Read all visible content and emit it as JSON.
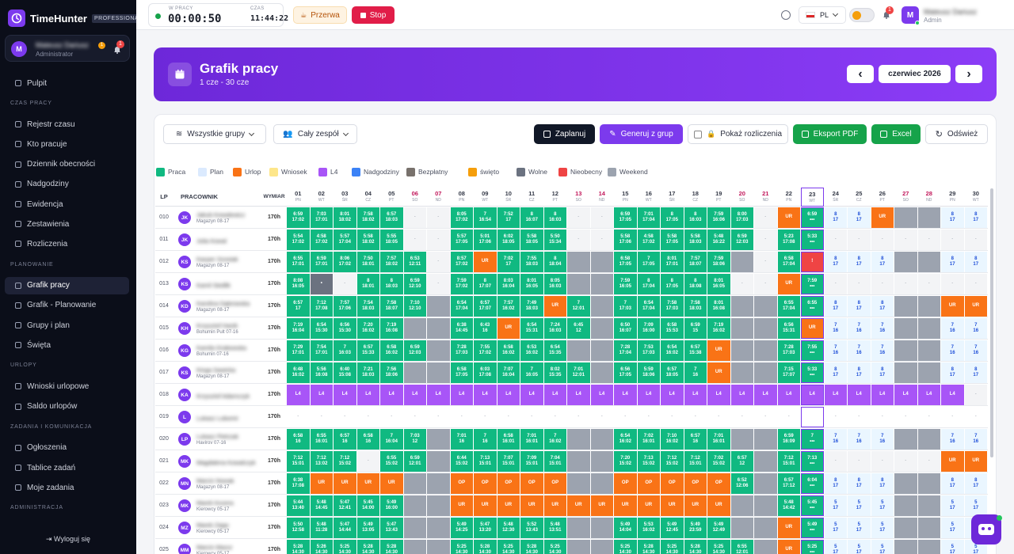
{
  "brand": {
    "name": "TimeHunter",
    "badge": "PROFESSIONAL"
  },
  "user": {
    "initial": "M",
    "name": "Mateusz Dariusz",
    "role": "Administrator",
    "badge_count": "1",
    "notif_count": "1"
  },
  "nav": [
    {
      "type": "item",
      "label": "Pulpit",
      "active": false
    },
    {
      "type": "section",
      "label": "CZAS PRACY"
    },
    {
      "type": "item",
      "label": "Rejestr czasu",
      "active": false
    },
    {
      "type": "item",
      "label": "Kto pracuje",
      "active": false
    },
    {
      "type": "item",
      "label": "Dziennik obecności",
      "active": false
    },
    {
      "type": "item",
      "label": "Nadgodziny",
      "active": false
    },
    {
      "type": "item",
      "label": "Ewidencja",
      "active": false
    },
    {
      "type": "item",
      "label": "Zestawienia",
      "active": false
    },
    {
      "type": "item",
      "label": "Rozliczenia",
      "active": false
    },
    {
      "type": "section",
      "label": "PLANOWANIE"
    },
    {
      "type": "item",
      "label": "Grafik pracy",
      "active": true
    },
    {
      "type": "item",
      "label": "Grafik - Planowanie",
      "active": false
    },
    {
      "type": "item",
      "label": "Grupy i plan",
      "active": false
    },
    {
      "type": "item",
      "label": "Święta",
      "active": false
    },
    {
      "type": "section",
      "label": "URLOPY"
    },
    {
      "type": "item",
      "label": "Wnioski urlopowe",
      "active": false
    },
    {
      "type": "item",
      "label": "Saldo urlopów",
      "active": false
    },
    {
      "type": "section",
      "label": "ZADANIA I KOMUNIKACJA"
    },
    {
      "type": "item",
      "label": "Ogłoszenia",
      "active": false
    },
    {
      "type": "item",
      "label": "Tablice zadań",
      "active": false
    },
    {
      "type": "item",
      "label": "Moje zadania",
      "active": false
    },
    {
      "type": "section",
      "label": "ADMINISTRACJA"
    }
  ],
  "logout_label": "Wyloguj się",
  "topbar": {
    "working_label": "W PRACY",
    "working_time": "00:00:50",
    "clock_label": "CZAS",
    "clock": "11:44:22",
    "break_label": "Przerwa",
    "stop_label": "Stop",
    "lang": "PL",
    "notif_count": "1",
    "user_initial": "M",
    "user_name": "Mateusz Dariusz",
    "user_role": "Admin"
  },
  "hero": {
    "title": "Grafik pracy",
    "subtitle": "1 cze - 30 cze",
    "month": "czerwiec 2026",
    "prev": "‹",
    "next": "›"
  },
  "toolbar": {
    "groups": "Wszystkie grupy",
    "team": "Cały zespół",
    "plan": "Zaplanuj",
    "generate": "Generuj z grup",
    "show_settlements": "Pokaż rozliczenia",
    "pdf": "Eksport PDF",
    "excel": "Excel",
    "refresh": "Odśwież"
  },
  "legend": [
    {
      "label": "Praca",
      "color": "#10b981"
    },
    {
      "label": "Plan",
      "color": "#dbeafe"
    },
    {
      "label": "Urlop",
      "color": "#f97316"
    },
    {
      "label": "Wniosek",
      "color": "#fde68a"
    },
    {
      "label": "L4",
      "color": "#a855f7"
    },
    {
      "label": "Nadgodziny",
      "color": "#3b82f6"
    },
    {
      "label": "Bezpłatny",
      "color": "#78716c"
    },
    {
      "label": "święto",
      "color": "#f59e0b"
    },
    {
      "label": "Wolne",
      "color": "#6b7280"
    },
    {
      "label": "Nieobecny",
      "color": "#ef4444"
    },
    {
      "label": "Weekend",
      "color": "#9ca3af"
    }
  ],
  "grid": {
    "headers": {
      "lp": "LP",
      "employee": "PRACOWNIK",
      "norm": "WYMIAR"
    },
    "days": [
      {
        "d": "01",
        "w": "PN"
      },
      {
        "d": "02",
        "w": "WT"
      },
      {
        "d": "03",
        "w": "ŚR"
      },
      {
        "d": "04",
        "w": "CZ"
      },
      {
        "d": "05",
        "w": "PT"
      },
      {
        "d": "06",
        "w": "SO"
      },
      {
        "d": "07",
        "w": "ND"
      },
      {
        "d": "08",
        "w": "PN"
      },
      {
        "d": "09",
        "w": "WT"
      },
      {
        "d": "10",
        "w": "ŚR"
      },
      {
        "d": "11",
        "w": "CZ"
      },
      {
        "d": "12",
        "w": "PT"
      },
      {
        "d": "13",
        "w": "SO"
      },
      {
        "d": "14",
        "w": "ND"
      },
      {
        "d": "15",
        "w": "PN"
      },
      {
        "d": "16",
        "w": "WT"
      },
      {
        "d": "17",
        "w": "ŚR"
      },
      {
        "d": "18",
        "w": "CZ"
      },
      {
        "d": "19",
        "w": "PT"
      },
      {
        "d": "20",
        "w": "SO"
      },
      {
        "d": "21",
        "w": "ND"
      },
      {
        "d": "22",
        "w": "PN"
      },
      {
        "d": "23",
        "w": "WT"
      },
      {
        "d": "24",
        "w": "ŚR"
      },
      {
        "d": "25",
        "w": "CZ"
      },
      {
        "d": "26",
        "w": "PT"
      },
      {
        "d": "27",
        "w": "SO"
      },
      {
        "d": "28",
        "w": "ND"
      },
      {
        "d": "29",
        "w": "PN"
      },
      {
        "d": "30",
        "w": "WT"
      }
    ],
    "today_index": 22,
    "rows": [
      {
        "lp": "010",
        "init": "JK",
        "name": "Jakub Kowalewicz",
        "dept": "Magazyn 08-17",
        "norm": "170h",
        "cells": [
          "P|6:59\n17:02",
          "P|7:03\n17:01",
          "P|8:01\n18:02",
          "P|7:58\n18:02",
          "P|6:57\n18:03",
          "D|-",
          "D|-",
          "P|8:05\n17:02",
          "P|7\n16:54",
          "P|7:52\n17",
          "P|8\n16:07",
          "P|8\n16:03",
          "D|-",
          "D|-",
          "P|6:59\n17:05",
          "P|7:01\n17:04",
          "P|8\n17:05",
          "P|8\n16:03",
          "P|7:59\n16:06",
          "P|8:00\n17:03",
          "D|-",
          "U|UR",
          "P|6:59\n•••",
          "PL|8\n17",
          "PL|8\n17",
          "U|UR",
          "W|",
          "W|",
          "PL|8\n17",
          "PL|8\n17"
        ]
      },
      {
        "lp": "011",
        "init": "JK",
        "name": "Julia Kowal",
        "dept": "",
        "norm": "170h",
        "cells": [
          "P|5:54\n17:02",
          "P|4:58\n17:02",
          "P|5:57\n17:04",
          "P|5:58\n18:02",
          "P|5:55\n18:05",
          "D|-",
          "D|-",
          "P|5:57\n17:05",
          "P|5:01\n17:06",
          "P|6:02\n18:05",
          "P|5:58\n18:05",
          "P|5:50\n15:34",
          "D|-",
          "D|-",
          "P|5:58\n17:06",
          "P|4:58\n17:02",
          "P|5:58\n17:05",
          "P|5:58\n18:03",
          "P|5:48\n16:22",
          "P|6:59\n12:03",
          "D|-",
          "P|5:23\n17:08",
          "P|5:33\n•••",
          "D|-",
          "D|-",
          "D|-",
          "D|-",
          "D|-",
          "D|-",
          "D|-"
        ]
      },
      {
        "lp": "012",
        "init": "KS",
        "name": "Kacper Szostak",
        "dept": "Magazyn 08-17",
        "norm": "170h",
        "cells": [
          "P|6:55\n17:01",
          "P|6:59\n17:01",
          "P|8:06\n17:02",
          "P|7:50\n18:01",
          "P|7:57\n18:02",
          "P|6:53\n12:11",
          "D|-",
          "P|8:57\n17:02",
          "O|UR",
          "P|7:02\n17",
          "P|7:55\n18:03",
          "P|8\n18:04",
          "W|",
          "W|",
          "P|6:58\n17:05",
          "P|7\n17:05",
          "P|8:01\n17:01",
          "P|7:57\n18:07",
          "P|7:59\n18:06",
          "W|",
          "D|-",
          "P|6:58\n17:04",
          "N|!",
          "PL|8\n17",
          "PL|8\n17",
          "PL|8\n17",
          "W|",
          "W|",
          "PL|8\n17",
          "PL|8\n17"
        ]
      },
      {
        "lp": "013",
        "init": "KS",
        "name": "Kamil Siedlik",
        "dept": "",
        "norm": "170h",
        "cells": [
          "P|8:08\n16:05",
          "B|•",
          "D|-",
          "P|8\n18:01",
          "P|8\n18:03",
          "P|6:59\n12:10",
          "D|-",
          "P|7:59\n17:02",
          "P|8\n17:07",
          "P|8:03\n16:04",
          "P|8:01\n16:05",
          "P|8:05\n16:03",
          "W|",
          "W|",
          "P|7:59\n16:05",
          "P|8\n17:04",
          "P|8\n17:05",
          "P|8\n18:08",
          "P|8:01\n16:05",
          "D|-",
          "D|-",
          "U|UR",
          "P|7:59\n•••",
          "D|-",
          "D|-",
          "D|-",
          "D|-",
          "D|-",
          "D|-",
          "D|-"
        ]
      },
      {
        "lp": "014",
        "init": "KD",
        "name": "Karolina Dąbrowska",
        "dept": "Magazyn 08-17",
        "norm": "170h",
        "cells": [
          "P|6:57\n17",
          "P|7:12\n17:08",
          "P|7:57\n17:06",
          "P|7:54\n18:03",
          "P|7:58\n18:07",
          "P|7:10\n12:10",
          "W|",
          "P|6:54\n17:04",
          "P|6:57\n17:07",
          "P|7:57\n16:02",
          "P|7:49\n18:03",
          "U|UR",
          "P|7\n12:01",
          "W|",
          "P|7\n17:03",
          "P|6:54\n17:04",
          "P|7:58\n17:03",
          "P|7:58\n18:03",
          "P|8:01\n16:08",
          "W|",
          "W|",
          "P|6:55\n17:04",
          "P|6:55\n•••",
          "PL|8\n17",
          "PL|8\n17",
          "PL|8\n17",
          "W|",
          "W|",
          "U|UR",
          "U|UR"
        ]
      },
      {
        "lp": "015",
        "init": "KH",
        "name": "Krzysztof Hanik",
        "dept": "Bohumin Pult 07-16",
        "norm": "170h",
        "cells": [
          "P|7:19\n16:04",
          "P|6:54\n15:30",
          "P|6:56\n15:30",
          "P|7:20\n16:02",
          "P|7:19\n16:08",
          "W|",
          "W|",
          "P|6:38\n14:45",
          "P|6:43\n16",
          "O|UR",
          "P|6:54\n15:31",
          "P|7:24\n16:03",
          "P|6:45\n12",
          "W|",
          "P|6:50\n16:07",
          "P|7:09\n16:00",
          "P|6:58\n15:53",
          "P|6:59\n15",
          "P|7:19\n16:02",
          "W|",
          "W|",
          "P|6:56\n15:31",
          "O|UR",
          "PL|7\n16",
          "PL|7\n16",
          "PL|7\n16",
          "W|",
          "W|",
          "PL|7\n16",
          "PL|7\n16"
        ]
      },
      {
        "lp": "016",
        "init": "KG",
        "name": "Kamila Grabowska",
        "dept": "Bohumin 07-16",
        "norm": "170h",
        "cells": [
          "P|7:29\n17:01",
          "P|7:54\n17:01",
          "P|7\n16:03",
          "P|6:57\n15:33",
          "P|6:58\n16:02",
          "P|6:59\n12:03",
          "W|",
          "P|7:28\n17:03",
          "P|7:55\n17:02",
          "P|6:58\n16:02",
          "P|6:53\n16:02",
          "P|6:54\n15:35",
          "W|",
          "W|",
          "P|7:28\n17:04",
          "P|7:53\n17:03",
          "P|6:54\n16:02",
          "P|6:57\n15:38",
          "O|UR",
          "W|",
          "W|",
          "P|7:28\n17:03",
          "P|7:55\n•••",
          "PL|7\n16",
          "PL|7\n16",
          "PL|7\n16",
          "W|",
          "W|",
          "PL|7\n16",
          "PL|7\n16"
        ]
      },
      {
        "lp": "017",
        "init": "KS",
        "name": "Kinga Sawicka",
        "dept": "Magazyn 08-17",
        "norm": "170h",
        "cells": [
          "P|6:48\n16:02",
          "P|5:56\n16:08",
          "P|6:40\n15:08",
          "P|7:21\n18:03",
          "P|7:56\n18:06",
          "W|",
          "W|",
          "P|6:58\n17:05",
          "P|6:03\n17:08",
          "P|7:07\n16:04",
          "P|7\n16:05",
          "P|8:02\n15:35",
          "P|7:01\n12:01",
          "W|",
          "P|6:56\n17:05",
          "P|5:59\n18:06",
          "P|6:57\n18:05",
          "P|7\n16",
          "O|UR",
          "W|",
          "W|",
          "P|7:15\n17:07",
          "P|5:33\n•••",
          "PL|8\n17",
          "PL|8\n17",
          "PL|8\n17",
          "W|",
          "W|",
          "PL|8\n17",
          "PL|8\n17"
        ]
      },
      {
        "lp": "018",
        "init": "KA",
        "name": "Krzysztof Adamczyk",
        "dept": "",
        "norm": "170h",
        "cells": [
          "L4|L4",
          "L4|L4",
          "L4|L4",
          "L4|L4",
          "L4|L4",
          "L4|L4",
          "L4|L4",
          "L4|L4",
          "L4|L4",
          "L4|L4",
          "L4|L4",
          "L4|L4",
          "L4|L4",
          "L4|L4",
          "L4|L4",
          "L4|L4",
          "L4|L4",
          "L4|L4",
          "L4|L4",
          "L4|L4",
          "L4|L4",
          "L4|L4",
          "L4|L4",
          "L4|L4",
          "L4|L4",
          "L4|L4",
          "L4|L4",
          "L4|L4",
          "L4|L4",
          "D|-"
        ]
      },
      {
        "lp": "019",
        "init": "L",
        "name": "Lukasz Lubomir",
        "dept": "",
        "norm": "170h",
        "cells": [
          "E|-",
          "E|-",
          "E|-",
          "E|-",
          "E|-",
          "E|-",
          "E|-",
          "E|-",
          "E|-",
          "E|-",
          "E|-",
          "E|-",
          "E|-",
          "E|-",
          "E|-",
          "E|-",
          "E|-",
          "E|-",
          "E|-",
          "E|-",
          "E|-",
          "E|-",
          "E|",
          "E|-",
          "E|-",
          "E|-",
          "E|-",
          "E|-",
          "E|-",
          "E|-"
        ]
      },
      {
        "lp": "020",
        "init": "LP",
        "name": "Lukasz Pietrzak",
        "dept": "Havirov 07-16",
        "norm": "170h",
        "cells": [
          "P|6:58\n16",
          "P|6:55\n16:01",
          "P|6:57\n16",
          "P|6:58\n16",
          "P|7\n16:04",
          "P|7:03\n12",
          "W|",
          "P|7:01\n16",
          "P|7\n16",
          "P|6:58\n16:01",
          "P|7:01\n16:01",
          "P|7\n16:02",
          "W|",
          "W|",
          "P|6:54\n16:02",
          "P|7:02\n16:01",
          "P|7:10\n16:02",
          "P|6:57\n16",
          "P|7:01\n16:01",
          "W|",
          "W|",
          "P|6:59\n16:09",
          "P|7\n•••",
          "PL|7\n16",
          "PL|7\n16",
          "PL|7\n16",
          "W|",
          "W|",
          "PL|7\n16",
          "PL|7\n16"
        ]
      },
      {
        "lp": "021",
        "init": "MK",
        "name": "Magdalena Kowalczyk",
        "dept": "",
        "norm": "170h",
        "cells": [
          "P|7:12\n15:01",
          "P|7:12\n13:02",
          "P|7:12\n15:02",
          "D|-",
          "P|6:55\n15:02",
          "P|6:59\n12:01",
          "W|",
          "P|6:44\n15:02",
          "P|7:13\n15:01",
          "P|7:07\n15:01",
          "P|7:09\n15:01",
          "P|7:04\n15:01",
          "W|",
          "W|",
          "P|7:20\n15:02",
          "P|7:13\n15:02",
          "P|7:12\n15:02",
          "P|7:12\n15:01",
          "P|7:02\n15:02",
          "P|6:57\n12",
          "W|",
          "P|7:12\n15:01",
          "P|7:13\n•••",
          "D|-",
          "D|-",
          "D|-",
          "D|-",
          "D|-",
          "U|UR",
          "U|UR"
        ]
      },
      {
        "lp": "022",
        "init": "MN",
        "name": "Marcin Nowak",
        "dept": "Magazyn 08-17",
        "norm": "170h",
        "cells": [
          "P|6:38\n17:08",
          "U|UR",
          "U|UR",
          "U|UR",
          "U|UR",
          "W|",
          "W|",
          "O|OP",
          "O|OP",
          "O|OP",
          "O|OP",
          "O|OP",
          "W|",
          "W|",
          "O|OP",
          "O|OP",
          "O|OP",
          "O|OP",
          "O|OP",
          "P|6:52\n12:06",
          "W|",
          "P|6:57\n17:12",
          "P|6:04\n•••",
          "PL|8\n17",
          "PL|8\n17",
          "PL|8\n17",
          "W|",
          "W|",
          "PL|8\n17",
          "PL|8\n17"
        ]
      },
      {
        "lp": "023",
        "init": "MK",
        "name": "Marek Kozera",
        "dept": "Kierowcy 05-17",
        "norm": "170h",
        "cells": [
          "P|5:44\n13:40",
          "P|5:48\n14:45",
          "P|5:47\n12:41",
          "P|5:45\n14:00",
          "P|5:49\n16:00",
          "W|",
          "W|",
          "U|UR",
          "U|UR",
          "U|UR",
          "U|UR",
          "U|UR",
          "U|UR",
          "U|UR",
          "U|UR",
          "U|UR",
          "U|UR",
          "U|UR",
          "U|UR",
          "W|",
          "W|",
          "P|5:48\n14:42",
          "P|5:45\n•••",
          "PL|5\n17",
          "PL|5\n17",
          "PL|5\n17",
          "W|",
          "W|",
          "PL|5\n17",
          "PL|5\n17"
        ]
      },
      {
        "lp": "024",
        "init": "MZ",
        "name": "Marek Zając",
        "dept": "Kierowcy 05-17",
        "norm": "170h",
        "cells": [
          "P|5:50\n12:58",
          "P|5:48\n11:28",
          "P|5:47\n14:44",
          "P|5:49\n13:05",
          "P|5:47\n13:43",
          "W|",
          "W|",
          "P|5:49\n14:25",
          "P|5:47\n13:20",
          "P|5:48\n12:30",
          "P|5:52\n13:43",
          "P|5:48\n13:51",
          "W|",
          "W|",
          "P|5:49\n14:04",
          "P|5:53\n16:02",
          "P|5:49\n12:45",
          "P|5:49\n23:59",
          "P|5:49\n12:49",
          "W|",
          "W|",
          "U|UR",
          "P|5:49\n•••",
          "PL|5\n17",
          "PL|5\n17",
          "PL|5\n17",
          "W|",
          "W|",
          "PL|5\n17",
          "PL|5\n17"
        ]
      },
      {
        "lp": "025",
        "init": "MM",
        "name": "Marcin Mazur",
        "dept": "Kierowcy 05-17",
        "norm": "170h",
        "cells": [
          "P|5:28\n14:30",
          "P|5:26\n14:30",
          "P|5:25\n14:30",
          "P|5:28\n14:30",
          "P|5:28\n14:30",
          "W|",
          "W|",
          "P|5:25\n14:30",
          "P|5:28\n14:30",
          "P|5:25\n14:30",
          "P|5:28\n14:30",
          "P|5:25\n14:30",
          "W|",
          "W|",
          "P|5:25\n14:30",
          "P|5:28\n14:30",
          "P|5:25\n14:30",
          "P|5:28\n14:30",
          "P|5:25\n14:30",
          "P|6:55\n12:01",
          "W|",
          "U|UR",
          "P|5:25\n•••",
          "PL|5\n17",
          "PL|5\n17",
          "PL|5\n17",
          "W|",
          "W|",
          "PL|5\n17",
          "PL|5\n17"
        ]
      }
    ]
  }
}
